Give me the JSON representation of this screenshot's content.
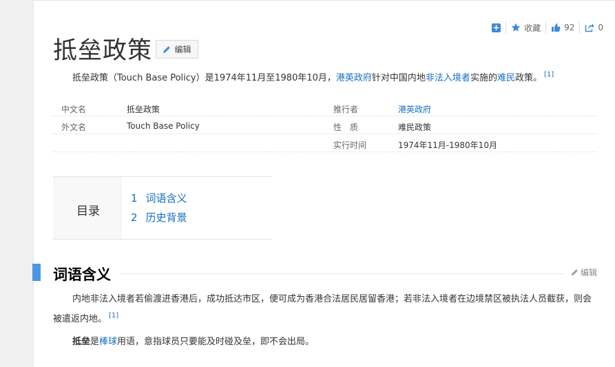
{
  "toolbar": {
    "favorite_label": "收藏",
    "like_count": "92",
    "share_count": "0",
    "accent_color": "#3d8ad8"
  },
  "title": "抵垒政策",
  "edit_label": "编辑",
  "summary": {
    "text1": "抵垒政策（Touch Base Policy）是1974年11月至1980年10月，",
    "link1": "港英政府",
    "text2": "针对中国内地",
    "link2": "非法入境者",
    "text3": "实施的",
    "link3": "难民",
    "text4": "政策。",
    "ref": "[1]"
  },
  "info": {
    "rows": [
      {
        "label_l": "中文名",
        "value_l": "抵垒政策",
        "label_r": "推行者",
        "value_r": "港英政府"
      },
      {
        "label_l": "外文名",
        "value_l": "Touch Base Policy",
        "label_r": "性　质",
        "value_r": "难民政策"
      },
      {
        "label_l": "",
        "value_l": "",
        "label_r": "实行时间",
        "value_r": "1974年11月-1980年10月"
      }
    ]
  },
  "toc": {
    "title": "目录",
    "items": [
      {
        "num": "1",
        "label": "词语含义"
      },
      {
        "num": "2",
        "label": "历史背景"
      }
    ]
  },
  "section1": {
    "title": "词语含义",
    "edit_label": "编辑",
    "para1": "内地非法入境者若偷渡进香港后，成功抵达市区，便可成为香港合法居民居留香港；若非法入境者在边境禁区被执法人员截获，则会被遣返内地。",
    "para1_ref": "[1]",
    "para2_bold": "抵垒",
    "para2_text1": "是",
    "para2_link": "棒球",
    "para2_text2": "用语，意指球员只要能及时碰及垒，即不会出局。"
  },
  "colors": {
    "link": "#136ec2",
    "section_bar": "#4b98e0"
  }
}
